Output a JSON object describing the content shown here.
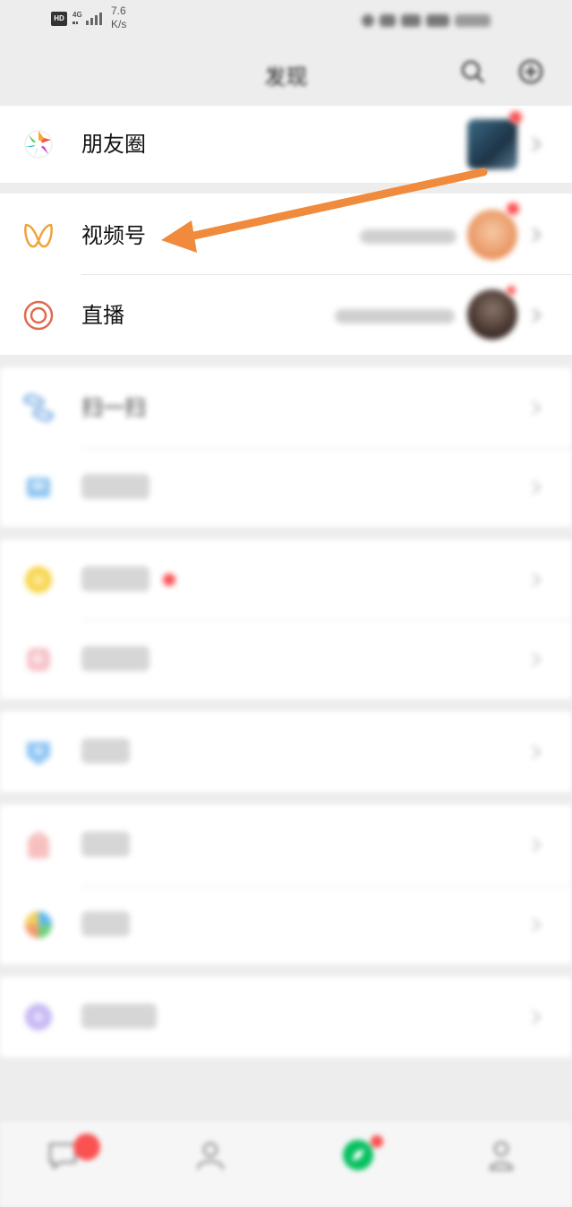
{
  "status_bar": {
    "network_badge": "HD",
    "signal_type": "4G",
    "speed_value": "7.6",
    "speed_unit": "K/s"
  },
  "header": {
    "title": "发现",
    "icons": [
      "search-icon",
      "plus-circle-icon"
    ]
  },
  "sections": [
    {
      "items": [
        {
          "label": "朋友圈",
          "icon": "moments-aperture-icon",
          "has_thumbnail": true,
          "badge": "red-dot"
        }
      ]
    },
    {
      "items": [
        {
          "label": "视频号",
          "icon": "channels-butterfly-icon",
          "has_thumbnail": true,
          "badge": "red-dot"
        },
        {
          "label": "直播",
          "icon": "live-ring-icon",
          "has_thumbnail": true,
          "badge": "red-dot"
        }
      ]
    },
    {
      "items": [
        {
          "label": "扫一扫",
          "icon": "scan-icon"
        },
        {
          "label": "",
          "icon": "shake-icon"
        }
      ]
    },
    {
      "items": [
        {
          "label": "",
          "icon": "top-stories-icon",
          "badge": "red-dot"
        },
        {
          "label": "",
          "icon": "search-feature-icon"
        }
      ]
    },
    {
      "items": [
        {
          "label": "",
          "icon": "nearby-icon"
        }
      ]
    },
    {
      "items": [
        {
          "label": "",
          "icon": "shopping-bag-icon"
        },
        {
          "label": "",
          "icon": "games-icon"
        }
      ]
    },
    {
      "items": [
        {
          "label": "",
          "icon": "mini-programs-icon"
        }
      ]
    }
  ],
  "tab_bar": {
    "tabs": [
      {
        "label": "",
        "icon": "chats-icon",
        "badge": "red-dot"
      },
      {
        "label": "",
        "icon": "contacts-icon"
      },
      {
        "label": "",
        "icon": "discover-icon",
        "active": true,
        "badge": "red-dot"
      },
      {
        "label": "",
        "icon": "me-icon"
      }
    ]
  },
  "annotation": {
    "type": "arrow",
    "color": "#f08a3c",
    "points_to": "视频号"
  },
  "colors": {
    "background": "#ededed",
    "card": "#ffffff",
    "badge_red": "#fa5151",
    "arrow_orange": "#f08a3c",
    "active_tab_green": "#07c160"
  }
}
